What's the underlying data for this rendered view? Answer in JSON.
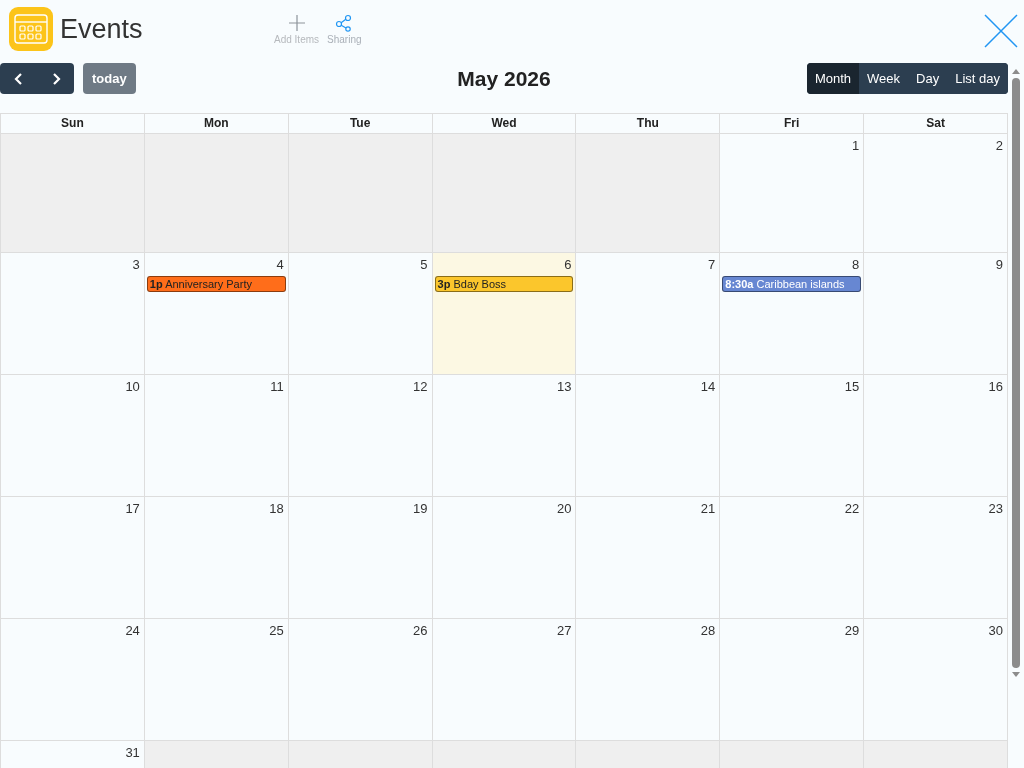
{
  "app": {
    "title": "Events"
  },
  "toolbar": [
    {
      "kind": "add",
      "label": "Add Items",
      "disabled": true
    },
    {
      "kind": "share",
      "label": "Sharing",
      "disabled": false
    }
  ],
  "nav": {
    "today": "today"
  },
  "calendar": {
    "title": "May 2026",
    "views": [
      {
        "label": "Month",
        "selected": true
      },
      {
        "label": "Week",
        "selected": false
      },
      {
        "label": "Day",
        "selected": false
      },
      {
        "label": "List day",
        "selected": false
      }
    ],
    "weekdays": [
      "Sun",
      "Mon",
      "Tue",
      "Wed",
      "Thu",
      "Fri",
      "Sat"
    ],
    "weeks": [
      [
        {
          "outside": true
        },
        {
          "outside": true
        },
        {
          "outside": true
        },
        {
          "outside": true
        },
        {
          "outside": true
        },
        {
          "outside": false,
          "today": false,
          "number": "1"
        },
        {
          "outside": false,
          "today": false,
          "number": "2"
        }
      ],
      [
        {
          "outside": false,
          "today": false,
          "number": "3"
        },
        {
          "outside": false,
          "today": false,
          "number": "4",
          "events": [
            {
              "time": "1p",
              "title": "Anniversary Party",
              "color": "#ff6d1a"
            }
          ]
        },
        {
          "outside": false,
          "today": false,
          "number": "5"
        },
        {
          "outside": false,
          "today": true,
          "number": "6",
          "events": [
            {
              "time": "3p",
              "title": "Bday Boss",
              "color": "#fbc62c"
            }
          ]
        },
        {
          "outside": false,
          "today": false,
          "number": "7"
        },
        {
          "outside": false,
          "today": false,
          "number": "8",
          "events": [
            {
              "time": "8:30a",
              "title": "Caribbean islands",
              "color": "#6787d2"
            }
          ]
        },
        {
          "outside": false,
          "today": false,
          "number": "9"
        }
      ],
      [
        {
          "outside": false,
          "today": false,
          "number": "10"
        },
        {
          "outside": false,
          "today": false,
          "number": "11"
        },
        {
          "outside": false,
          "today": false,
          "number": "12"
        },
        {
          "outside": false,
          "today": false,
          "number": "13"
        },
        {
          "outside": false,
          "today": false,
          "number": "14"
        },
        {
          "outside": false,
          "today": false,
          "number": "15"
        },
        {
          "outside": false,
          "today": false,
          "number": "16"
        }
      ],
      [
        {
          "outside": false,
          "today": false,
          "number": "17"
        },
        {
          "outside": false,
          "today": false,
          "number": "18"
        },
        {
          "outside": false,
          "today": false,
          "number": "19"
        },
        {
          "outside": false,
          "today": false,
          "number": "20"
        },
        {
          "outside": false,
          "today": false,
          "number": "21"
        },
        {
          "outside": false,
          "today": false,
          "number": "22"
        },
        {
          "outside": false,
          "today": false,
          "number": "23"
        }
      ],
      [
        {
          "outside": false,
          "today": false,
          "number": "24"
        },
        {
          "outside": false,
          "today": false,
          "number": "25"
        },
        {
          "outside": false,
          "today": false,
          "number": "26"
        },
        {
          "outside": false,
          "today": false,
          "number": "27"
        },
        {
          "outside": false,
          "today": false,
          "number": "28"
        },
        {
          "outside": false,
          "today": false,
          "number": "29"
        },
        {
          "outside": false,
          "today": false,
          "number": "30"
        }
      ],
      [
        {
          "outside": false,
          "today": false,
          "number": "31"
        },
        {
          "outside": true
        },
        {
          "outside": true
        },
        {
          "outside": true
        },
        {
          "outside": true
        },
        {
          "outside": true
        },
        {
          "outside": true
        }
      ]
    ]
  }
}
